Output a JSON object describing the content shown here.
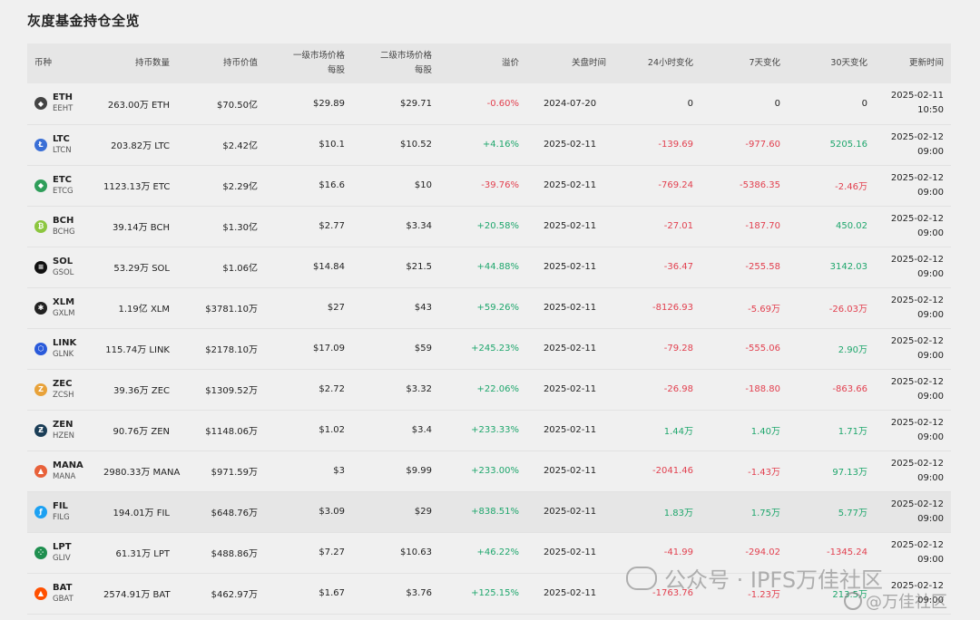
{
  "title": "灰度基金持仓全览",
  "headers": {
    "coin": "币种",
    "quantity": "持币数量",
    "value": "持币价值",
    "primary_price": "一级市场价格",
    "primary_price_unit": "每股",
    "secondary_price": "二级市场价格",
    "secondary_price_unit": "每股",
    "premium": "溢价",
    "close_time": "关盘时间",
    "change_24h": "24小时变化",
    "change_7d": "7天变化",
    "change_30d": "30天变化",
    "updated": "更新时间"
  },
  "rows": [
    {
      "sym": "ETH",
      "sub": "EEHT",
      "icon": "eth-icon",
      "color": "#444444",
      "glyph": "◆",
      "qty": "263.00万 ETH",
      "value": "$70.50亿",
      "p1": "$29.89",
      "p2": "$29.71",
      "premium": "-0.60%",
      "pdir": "neg",
      "close": "2024-07-20",
      "c24": "0",
      "c24dir": "",
      "c7": "0",
      "c7dir": "",
      "c30": "0",
      "c30dir": "",
      "date": "2025-02-11",
      "time": "10:50"
    },
    {
      "sym": "LTC",
      "sub": "LTCN",
      "icon": "ltc-icon",
      "color": "#3a6fd6",
      "glyph": "Ł",
      "qty": "203.82万 LTC",
      "value": "$2.42亿",
      "p1": "$10.1",
      "p2": "$10.52",
      "premium": "+4.16%",
      "pdir": "pos",
      "close": "2025-02-11",
      "c24": "-139.69",
      "c24dir": "neg",
      "c7": "-977.60",
      "c7dir": "neg",
      "c30": "5205.16",
      "c30dir": "pos",
      "date": "2025-02-12",
      "time": "09:00"
    },
    {
      "sym": "ETC",
      "sub": "ETCG",
      "icon": "etc-icon",
      "color": "#2f9e5a",
      "glyph": "◆",
      "qty": "1123.13万 ETC",
      "value": "$2.29亿",
      "p1": "$16.6",
      "p2": "$10",
      "premium": "-39.76%",
      "pdir": "neg",
      "close": "2025-02-11",
      "c24": "-769.24",
      "c24dir": "neg",
      "c7": "-5386.35",
      "c7dir": "neg",
      "c30": "-2.46万",
      "c30dir": "neg",
      "date": "2025-02-12",
      "time": "09:00"
    },
    {
      "sym": "BCH",
      "sub": "BCHG",
      "icon": "bch-icon",
      "color": "#8cc63f",
      "glyph": "₿",
      "qty": "39.14万 BCH",
      "value": "$1.30亿",
      "p1": "$2.77",
      "p2": "$3.34",
      "premium": "+20.58%",
      "pdir": "pos",
      "close": "2025-02-11",
      "c24": "-27.01",
      "c24dir": "neg",
      "c7": "-187.70",
      "c7dir": "neg",
      "c30": "450.02",
      "c30dir": "pos",
      "date": "2025-02-12",
      "time": "09:00"
    },
    {
      "sym": "SOL",
      "sub": "GSOL",
      "icon": "sol-icon",
      "color": "#111111",
      "glyph": "≡",
      "qty": "53.29万 SOL",
      "value": "$1.06亿",
      "p1": "$14.84",
      "p2": "$21.5",
      "premium": "+44.88%",
      "pdir": "pos",
      "close": "2025-02-11",
      "c24": "-36.47",
      "c24dir": "neg",
      "c7": "-255.58",
      "c7dir": "neg",
      "c30": "3142.03",
      "c30dir": "pos",
      "date": "2025-02-12",
      "time": "09:00"
    },
    {
      "sym": "XLM",
      "sub": "GXLM",
      "icon": "xlm-icon",
      "color": "#222222",
      "glyph": "✱",
      "qty": "1.19亿 XLM",
      "value": "$3781.10万",
      "p1": "$27",
      "p2": "$43",
      "premium": "+59.26%",
      "pdir": "pos",
      "close": "2025-02-11",
      "c24": "-8126.93",
      "c24dir": "neg",
      "c7": "-5.69万",
      "c7dir": "neg",
      "c30": "-26.03万",
      "c30dir": "neg",
      "date": "2025-02-12",
      "time": "09:00"
    },
    {
      "sym": "LINK",
      "sub": "GLNK",
      "icon": "link-icon",
      "color": "#2a5ada",
      "glyph": "⬡",
      "qty": "115.74万 LINK",
      "value": "$2178.10万",
      "p1": "$17.09",
      "p2": "$59",
      "premium": "+245.23%",
      "pdir": "pos",
      "close": "2025-02-11",
      "c24": "-79.28",
      "c24dir": "neg",
      "c7": "-555.06",
      "c7dir": "neg",
      "c30": "2.90万",
      "c30dir": "pos",
      "date": "2025-02-12",
      "time": "09:00"
    },
    {
      "sym": "ZEC",
      "sub": "ZCSH",
      "icon": "zec-icon",
      "color": "#e8a23a",
      "glyph": "Z",
      "qty": "39.36万 ZEC",
      "value": "$1309.52万",
      "p1": "$2.72",
      "p2": "$3.32",
      "premium": "+22.06%",
      "pdir": "pos",
      "close": "2025-02-11",
      "c24": "-26.98",
      "c24dir": "neg",
      "c7": "-188.80",
      "c7dir": "neg",
      "c30": "-863.66",
      "c30dir": "neg",
      "date": "2025-02-12",
      "time": "09:00"
    },
    {
      "sym": "ZEN",
      "sub": "HZEN",
      "icon": "zen-icon",
      "color": "#1b3e57",
      "glyph": "Ƶ",
      "qty": "90.76万 ZEN",
      "value": "$1148.06万",
      "p1": "$1.02",
      "p2": "$3.4",
      "premium": "+233.33%",
      "pdir": "pos",
      "close": "2025-02-11",
      "c24": "1.44万",
      "c24dir": "pos",
      "c7": "1.40万",
      "c7dir": "pos",
      "c30": "1.71万",
      "c30dir": "pos",
      "date": "2025-02-12",
      "time": "09:00"
    },
    {
      "sym": "MANA",
      "sub": "MANA",
      "icon": "mana-icon",
      "color": "#e8613a",
      "glyph": "▲",
      "qty": "2980.33万 MANA",
      "value": "$971.59万",
      "p1": "$3",
      "p2": "$9.99",
      "premium": "+233.00%",
      "pdir": "pos",
      "close": "2025-02-11",
      "c24": "-2041.46",
      "c24dir": "neg",
      "c7": "-1.43万",
      "c7dir": "neg",
      "c30": "97.13万",
      "c30dir": "pos",
      "date": "2025-02-12",
      "time": "09:00"
    },
    {
      "sym": "FIL",
      "sub": "FILG",
      "icon": "fil-icon",
      "color": "#1da1f2",
      "glyph": "ƒ",
      "qty": "194.01万 FIL",
      "value": "$648.76万",
      "p1": "$3.09",
      "p2": "$29",
      "premium": "+838.51%",
      "pdir": "pos",
      "close": "2025-02-11",
      "c24": "1.83万",
      "c24dir": "pos",
      "c7": "1.75万",
      "c7dir": "pos",
      "c30": "5.77万",
      "c30dir": "pos",
      "date": "2025-02-12",
      "time": "09:00"
    },
    {
      "sym": "LPT",
      "sub": "GLIV",
      "icon": "lpt-icon",
      "color": "#1f8f4f",
      "glyph": "⁘",
      "qty": "61.31万 LPT",
      "value": "$488.86万",
      "p1": "$7.27",
      "p2": "$10.63",
      "premium": "+46.22%",
      "pdir": "pos",
      "close": "2025-02-11",
      "c24": "-41.99",
      "c24dir": "neg",
      "c7": "-294.02",
      "c7dir": "neg",
      "c30": "-1345.24",
      "c30dir": "neg",
      "date": "2025-02-12",
      "time": "09:00"
    },
    {
      "sym": "BAT",
      "sub": "GBAT",
      "icon": "bat-icon",
      "color": "#ff5000",
      "glyph": "▲",
      "qty": "2574.91万 BAT",
      "value": "$462.97万",
      "p1": "$1.67",
      "p2": "$3.76",
      "premium": "+125.15%",
      "pdir": "pos",
      "close": "2025-02-11",
      "c24": "-1763.76",
      "c24dir": "neg",
      "c7": "-1.23万",
      "c7dir": "neg",
      "c30": "213.5万",
      "c30dir": "pos",
      "date": "2025-02-12",
      "time": "09:00"
    }
  ],
  "highlight_row": 10,
  "watermark": {
    "text": "公众号 · IPFS万佳社区",
    "text2": "@万佳社区"
  }
}
